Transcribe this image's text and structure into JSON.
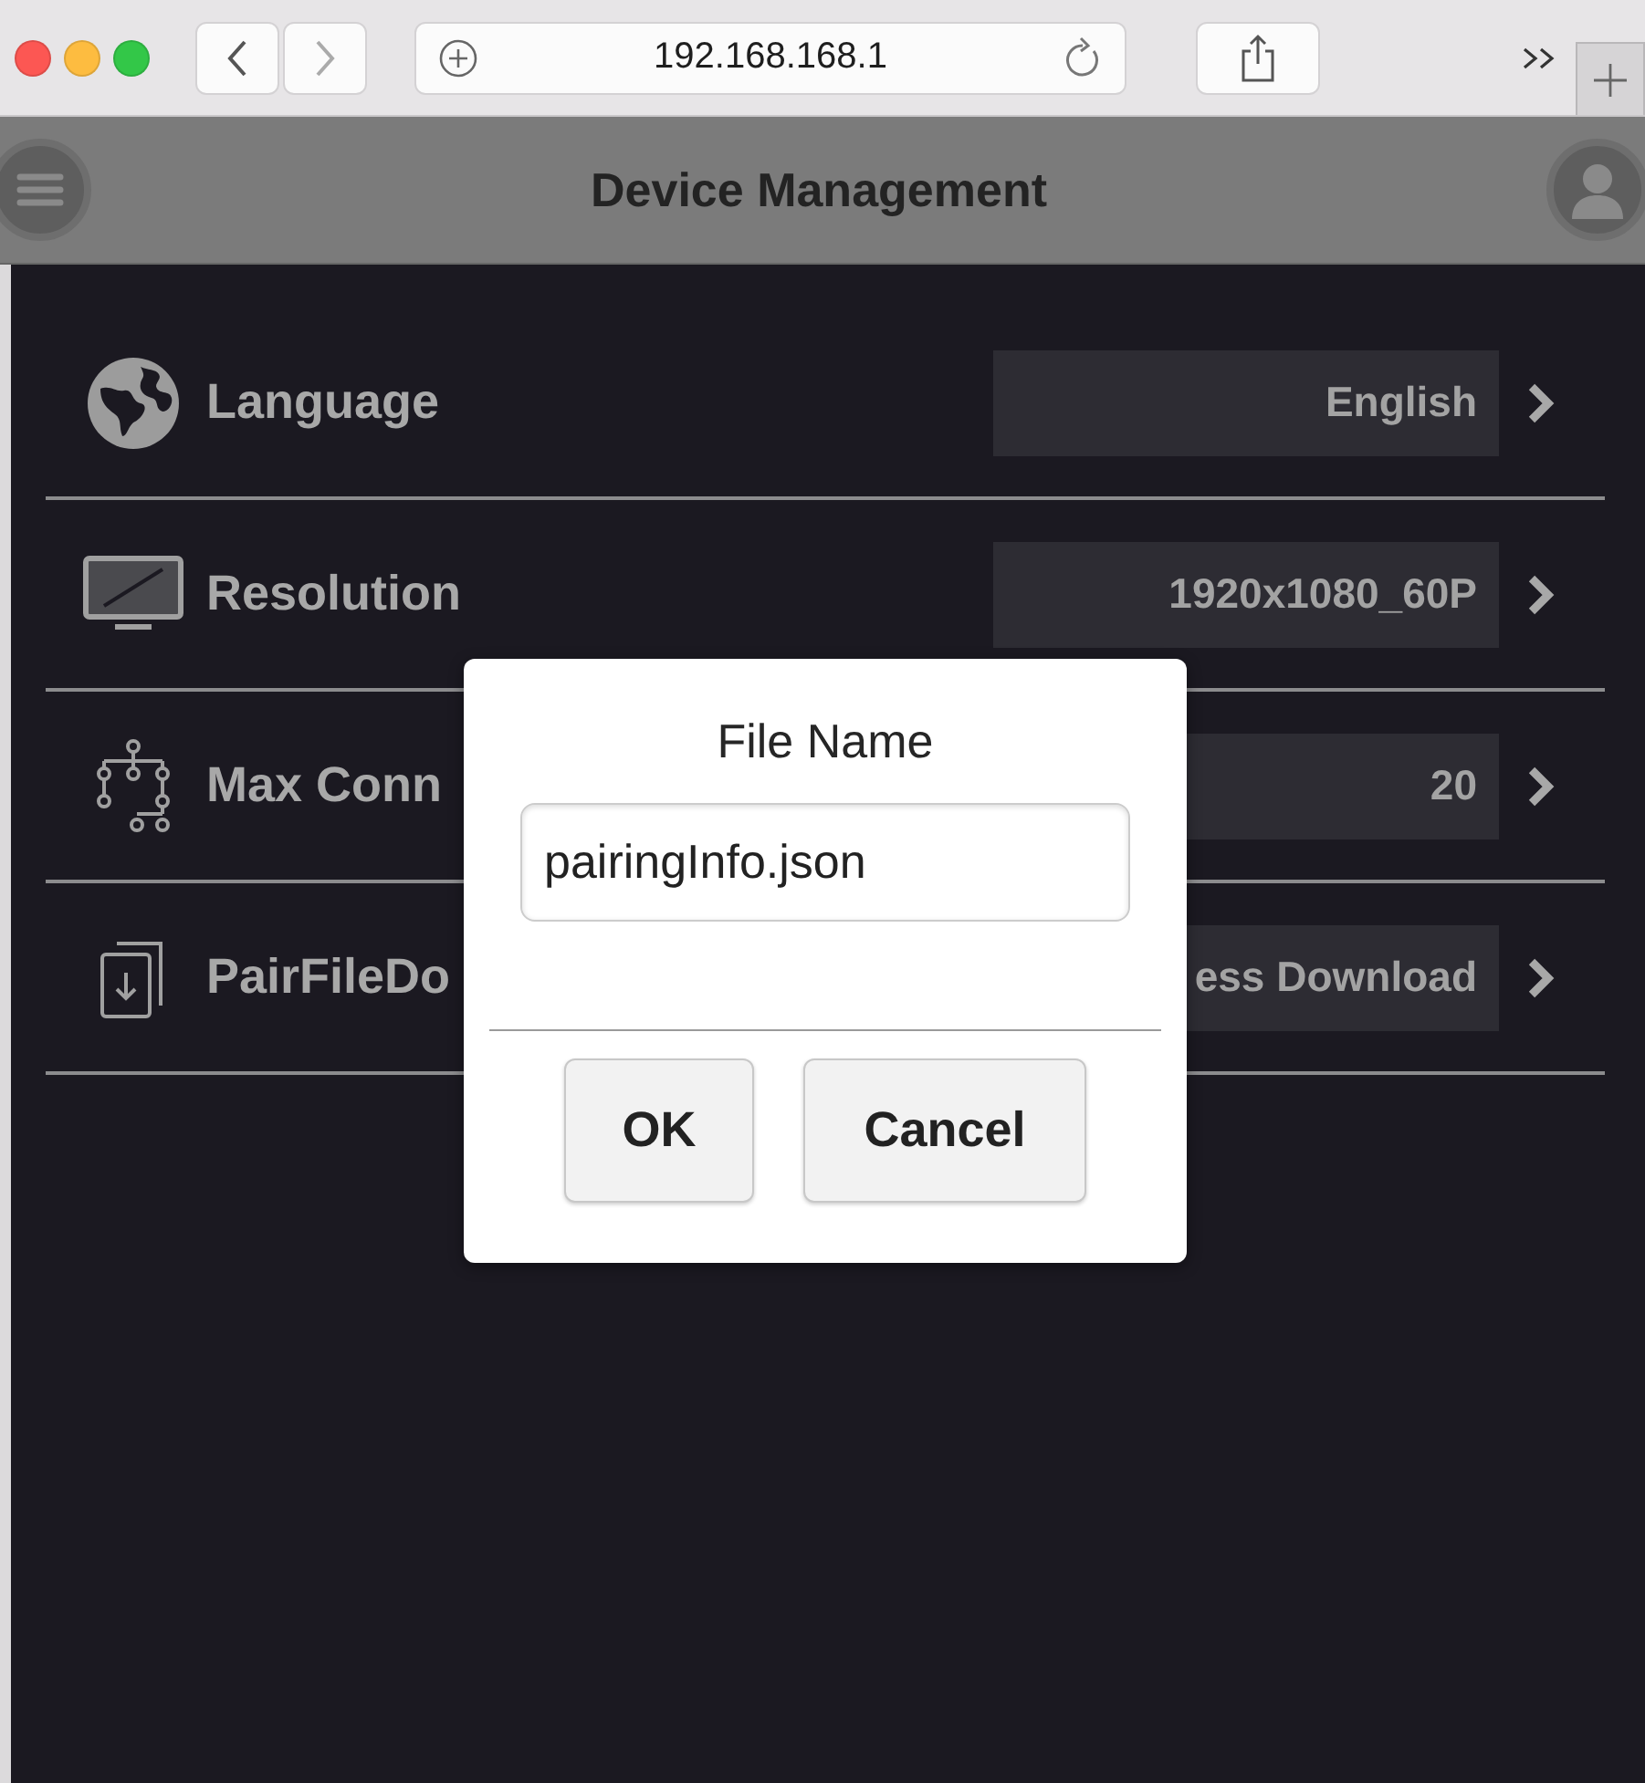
{
  "browser": {
    "url": "192.168.168.1"
  },
  "header": {
    "title": "Device Management"
  },
  "settings": [
    {
      "kind": "globe",
      "label": "Language",
      "value": "English"
    },
    {
      "kind": "monitor",
      "label": "Resolution",
      "value": "1920x1080_60P"
    },
    {
      "kind": "network",
      "label": "Max Conn",
      "value": "20"
    },
    {
      "kind": "download",
      "label": "PairFileDo",
      "value": "ess Download"
    }
  ],
  "dialog": {
    "title": "File Name",
    "value": "pairingInfo.json",
    "buttons": [
      "OK",
      "Cancel"
    ]
  }
}
